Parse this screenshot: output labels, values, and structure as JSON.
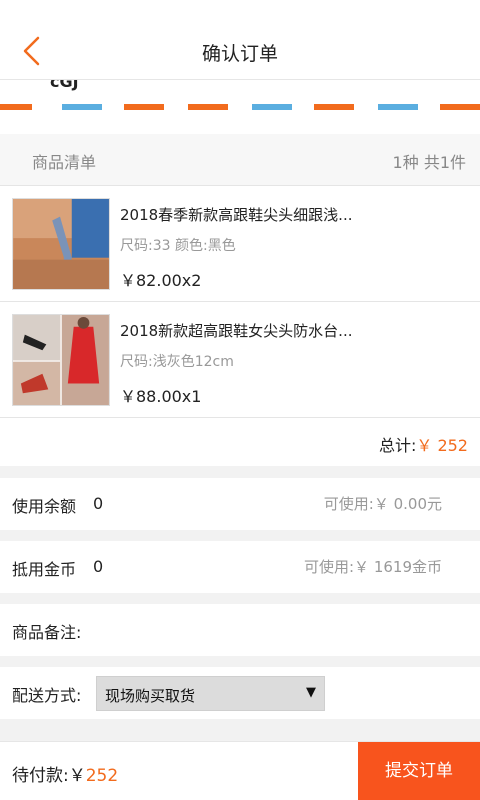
{
  "header": {
    "title": "确认订单",
    "back_icon": "chevron-left-icon",
    "accent": "#f26b1d"
  },
  "address": {
    "name": "cGJ"
  },
  "goods": {
    "label": "商品清单",
    "count": "1种 共1件",
    "items": [
      {
        "title": "2018春季新款高跟鞋尖头细跟浅...",
        "spec": "尺码:33 颜色:黑色",
        "price": "￥82.00x2"
      },
      {
        "title": "2018新款超高跟鞋女尖头防水台...",
        "spec": "尺码:浅灰色12cm",
        "price": "￥88.00x1"
      }
    ],
    "total_label": "总计:",
    "total_value": "￥ 252"
  },
  "balance": {
    "label": "使用余额",
    "value": "0",
    "available": "可使用:￥ 0.00元"
  },
  "coins": {
    "label": "抵用金币",
    "value": "0",
    "available": "可使用:￥ 1619金币"
  },
  "remark": {
    "label": "商品备注:"
  },
  "delivery": {
    "label": "配送方式:",
    "selected": "现场购买取货"
  },
  "footer": {
    "pay_label": "待付款:",
    "pay_currency": "￥",
    "pay_amount": "252",
    "submit_label": "提交订单",
    "submit_color": "#f8541d"
  }
}
